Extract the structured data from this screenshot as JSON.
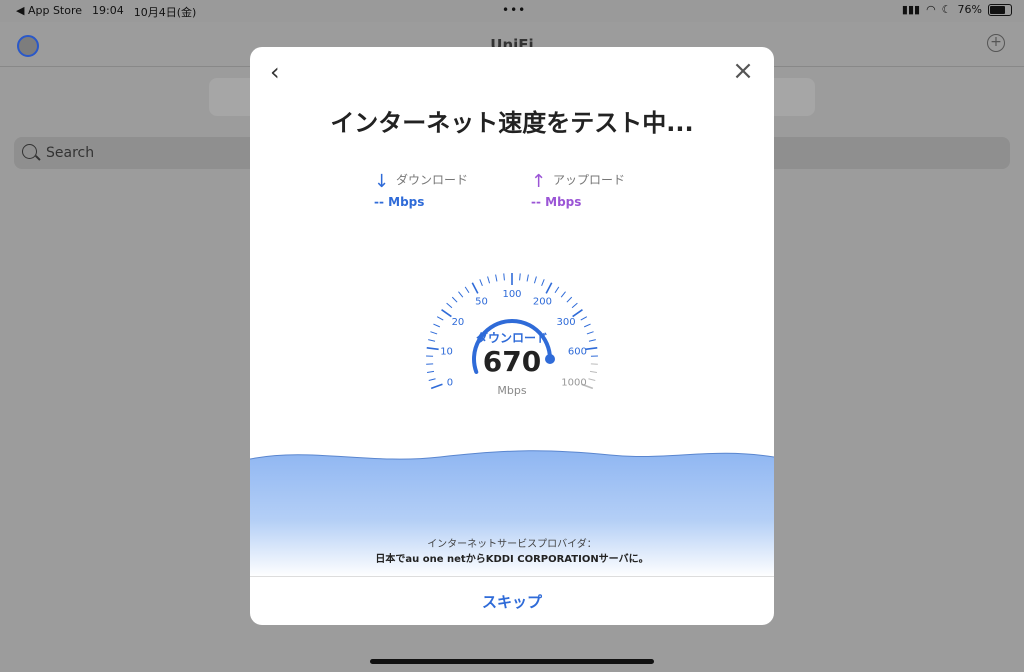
{
  "status_bar": {
    "back_app": "◀ App Store",
    "time": "19:04",
    "date": "10月4日(金)",
    "battery": "76%",
    "battery_level": 0.76
  },
  "app": {
    "title": "UniFi",
    "search_placeholder": "Search"
  },
  "modal": {
    "title": "インターネット速度をテスト中...",
    "download": {
      "label": "ダウンロード",
      "value": "-- Mbps",
      "arrow": "↓",
      "color": "#2f6bd8"
    },
    "upload": {
      "label": "アップロード",
      "value": "-- Mbps",
      "arrow": "↑",
      "color": "#9b55d6"
    },
    "gauge": {
      "label": "ダウンロード",
      "value": "670",
      "unit": "Mbps",
      "ticks": [
        "0",
        "10",
        "20",
        "50",
        "100",
        "200",
        "300",
        "600",
        "1000"
      ],
      "accent": "#2f6bd8"
    },
    "isp_label": "インターネットサービスプロバイダ：",
    "isp_value": "日本でau one netからKDDI CORPORATIONサーバに。",
    "skip_label": "スキップ"
  }
}
